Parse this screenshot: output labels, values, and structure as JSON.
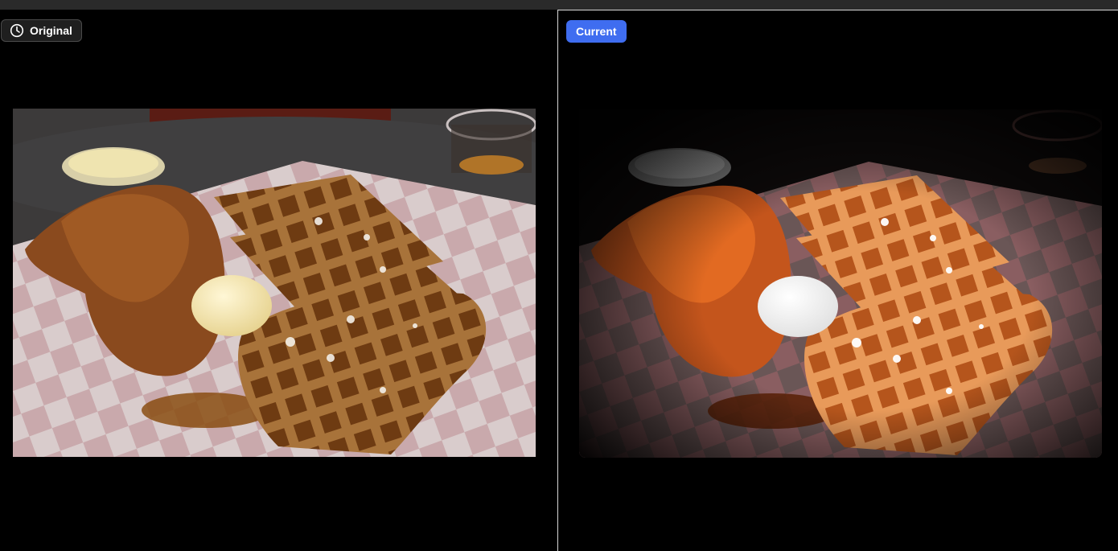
{
  "compare_view": {
    "original_label": "Original",
    "current_label": "Current"
  },
  "icons": {
    "original_badge_icon": "clock-icon"
  },
  "colors": {
    "accent": "#3f6df0",
    "background": "#000000",
    "divider": "#d8d8d8"
  }
}
